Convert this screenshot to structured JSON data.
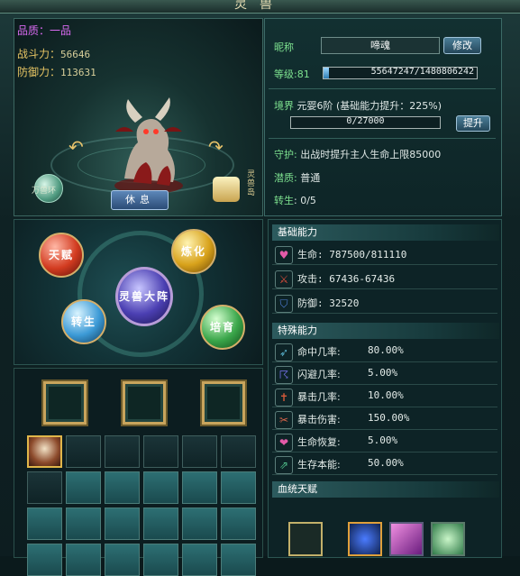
{
  "window": {
    "title": "灵兽"
  },
  "pet": {
    "quality_label": "品质：一品",
    "combat_power_label": "战斗力：",
    "combat_power": "56646",
    "defense_power_label": "防御力：",
    "defense_power": "113631",
    "left_orb_label": "万兽环",
    "right_vertical_label": "灵兽岛",
    "rest_label": "休息"
  },
  "info": {
    "nickname_label": "昵称",
    "nickname": "啼魂",
    "rename_label": "修改",
    "level_label": "等级",
    "level_value": ":81",
    "xp_text": "55647247/1480806242",
    "xp_fraction": 0.0376,
    "realm_label": "境界",
    "realm_text": "元婴6阶 (基础能力提升：225%)",
    "stage_text": "0/27000",
    "stage_fraction": 0,
    "upgrade_label": "提升",
    "guard_label": "守护",
    "guard_text": "出战时提升主人生命上限85000",
    "potential_label": "潜质",
    "potential_text": "普通",
    "rebirth_label": "转生",
    "rebirth_text": ": 0/5"
  },
  "formation": {
    "talent": "天赋",
    "refine": "炼化",
    "center": "灵兽大阵",
    "rebirth": "转生",
    "cultivate": "培育"
  },
  "stats": {
    "basic_title": "基础能力",
    "basic": [
      {
        "icon": "heart-icon",
        "text": "生命: 787500/811110",
        "color": "#e35aa8"
      },
      {
        "icon": "crossed-swords-icon",
        "text": "攻击: 67436-67436",
        "color": "#d44a3a"
      },
      {
        "icon": "shield-icon",
        "text": "防御: 32520",
        "color": "#4f7fd8"
      }
    ],
    "special_title": "特殊能力",
    "special": [
      {
        "icon": "arrow-icon",
        "label": "命中几率:",
        "value": "80.00%",
        "color": "#5ab4cf"
      },
      {
        "icon": "dodge-icon",
        "label": "闪避几率:",
        "value": "5.00%",
        "color": "#6b6bd8"
      },
      {
        "icon": "crit-icon",
        "label": "暴击几率:",
        "value": "10.00%",
        "color": "#d45a3a"
      },
      {
        "icon": "crit-damage-icon",
        "label": "暴击伤害:",
        "value": "150.00%",
        "color": "#d4634a"
      },
      {
        "icon": "heart-regen-icon",
        "label": "生命恢复:",
        "value": "5.00%",
        "color": "#e35aa8"
      },
      {
        "icon": "survival-icon",
        "label": "生存本能:",
        "value": "50.00%",
        "color": "#4fbf8a"
      }
    ],
    "bloodline_title": "血统天赋"
  }
}
